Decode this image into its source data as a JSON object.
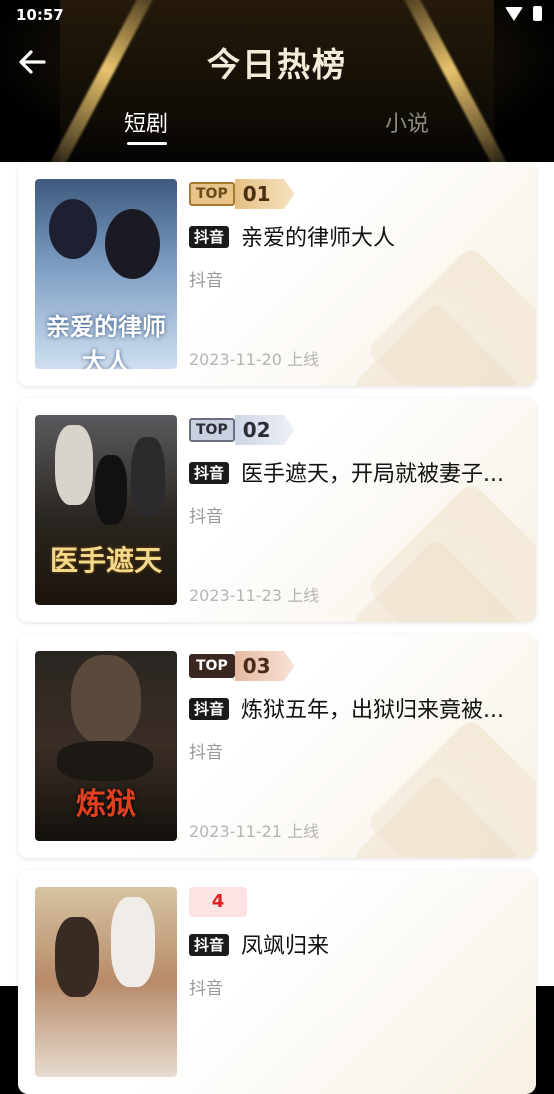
{
  "status_bar": {
    "time": "10:57"
  },
  "header": {
    "title": "今日热榜"
  },
  "tabs": [
    {
      "label": "短剧",
      "active": true
    },
    {
      "label": "小说",
      "active": false
    }
  ],
  "cards": [
    {
      "rank_top": "TOP",
      "rank_num": "01",
      "tag": "抖音",
      "title": "亲爱的律师大人",
      "platform": "抖音",
      "date": "2023-11-20 上线",
      "poster_text": "亲爱的律师大人"
    },
    {
      "rank_top": "TOP",
      "rank_num": "02",
      "tag": "抖音",
      "title": "医手遮天，开局就被妻子...",
      "platform": "抖音",
      "date": "2023-11-23 上线",
      "poster_text": "医手遮天"
    },
    {
      "rank_top": "TOP",
      "rank_num": "03",
      "tag": "抖音",
      "title": "炼狱五年，出狱归来竟被...",
      "platform": "抖音",
      "date": "2023-11-21 上线",
      "poster_text": "炼狱"
    },
    {
      "rank_num": "4",
      "tag": "抖音",
      "title": "凤飒归来",
      "platform": "抖音"
    }
  ],
  "colors": {
    "accent_gold": "#e6c084",
    "rank_plain_red": "#e02020"
  }
}
